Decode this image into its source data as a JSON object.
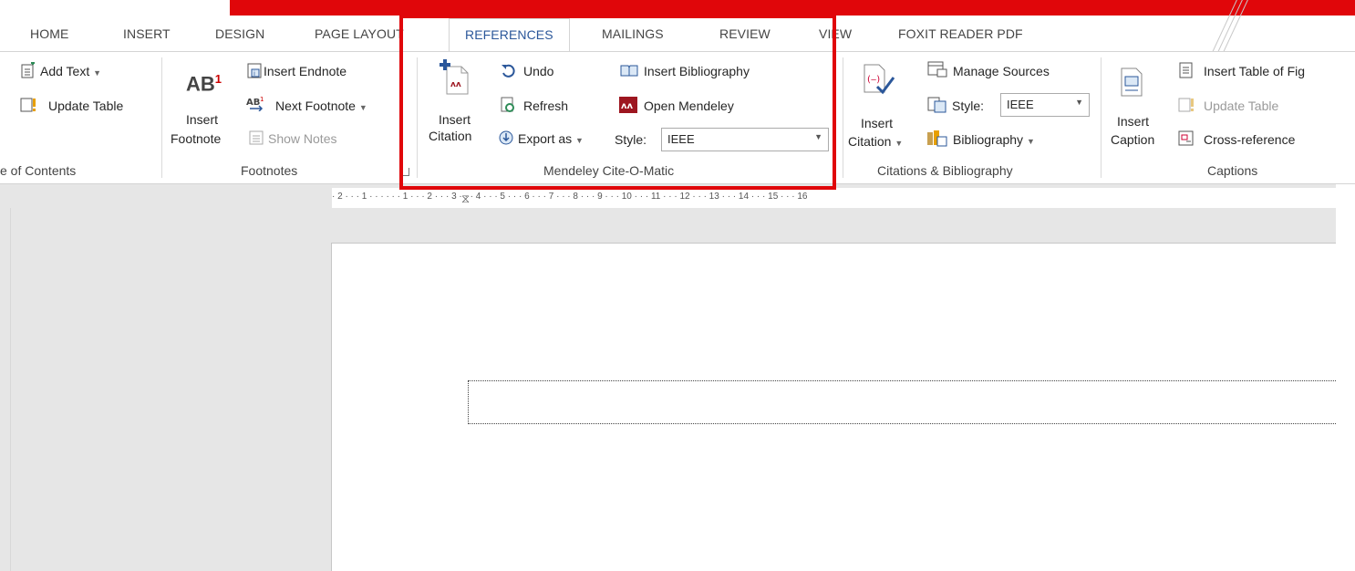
{
  "tabs": [
    "HOME",
    "INSERT",
    "DESIGN",
    "PAGE LAYOUT",
    "REFERENCES",
    "MAILINGS",
    "REVIEW",
    "VIEW",
    "FOXIT READER PDF"
  ],
  "active_tab": "REFERENCES",
  "toc": {
    "add_text": "Add Text",
    "update_table": "Update Table",
    "group_label": "e of Contents"
  },
  "footnotes": {
    "ab_glyph": "AB",
    "insert_footnote_1": "Insert",
    "insert_footnote_2": "Footnote",
    "insert_endnote": "Insert Endnote",
    "next_footnote": "Next Footnote",
    "show_notes": "Show Notes",
    "group_label": "Footnotes"
  },
  "mendeley": {
    "insert_citation_1": "Insert",
    "insert_citation_2": "Citation",
    "undo": "Undo",
    "refresh": "Refresh",
    "export_as": "Export as",
    "insert_bibliography": "Insert Bibliography",
    "open_mendeley": "Open Mendeley",
    "style_label": "Style:",
    "style_value": "IEEE",
    "group_label": "Mendeley Cite-O-Matic"
  },
  "citations": {
    "insert_citation_1": "Insert",
    "insert_citation_2": "Citation",
    "manage_sources": "Manage Sources",
    "style_label": "Style:",
    "style_value": "IEEE",
    "bibliography": "Bibliography",
    "group_label": "Citations & Bibliography"
  },
  "captions": {
    "insert_caption_1": "Insert",
    "insert_caption_2": "Caption",
    "insert_table_of_fig": "Insert Table of Fig",
    "update_table": "Update Table",
    "cross_reference": "Cross-reference",
    "group_label": "Captions"
  },
  "ruler_text": "· 2 · · · 1 · · ·   · · · 1 · · · 2 · · · 3 · · · 4 · · · 5 · · · 6 · · · 7 · · · 8 · · · 9 · · · 10 · · · 11 · · · 12 · · · 13 · · · 14 · · · 15 · · · 16",
  "colors": {
    "accent": "#2b579a",
    "highlight": "#e0060a",
    "mendeley": "#9d1620"
  }
}
